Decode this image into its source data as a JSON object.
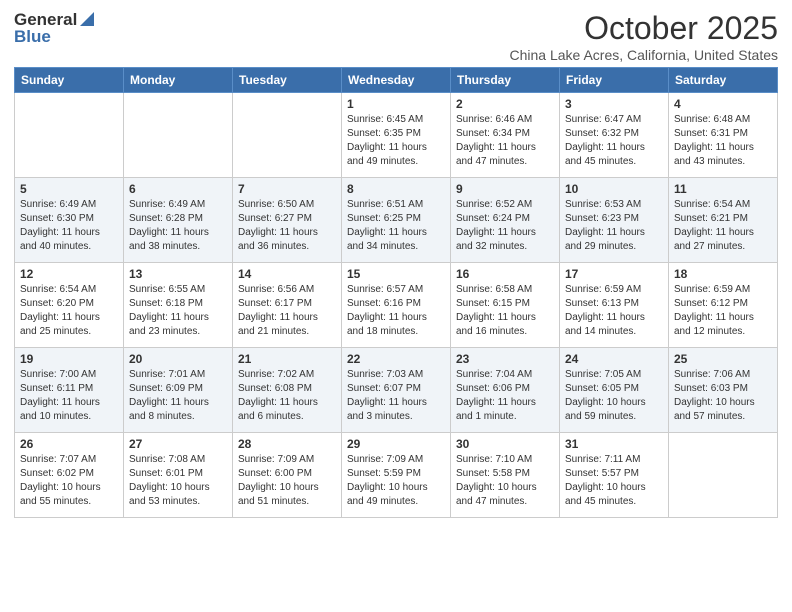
{
  "logo": {
    "general": "General",
    "blue": "Blue"
  },
  "title": "October 2025",
  "subtitle": "China Lake Acres, California, United States",
  "weekdays": [
    "Sunday",
    "Monday",
    "Tuesday",
    "Wednesday",
    "Thursday",
    "Friday",
    "Saturday"
  ],
  "weeks": [
    [
      {
        "day": "",
        "info": ""
      },
      {
        "day": "",
        "info": ""
      },
      {
        "day": "",
        "info": ""
      },
      {
        "day": "1",
        "info": "Sunrise: 6:45 AM\nSunset: 6:35 PM\nDaylight: 11 hours\nand 49 minutes."
      },
      {
        "day": "2",
        "info": "Sunrise: 6:46 AM\nSunset: 6:34 PM\nDaylight: 11 hours\nand 47 minutes."
      },
      {
        "day": "3",
        "info": "Sunrise: 6:47 AM\nSunset: 6:32 PM\nDaylight: 11 hours\nand 45 minutes."
      },
      {
        "day": "4",
        "info": "Sunrise: 6:48 AM\nSunset: 6:31 PM\nDaylight: 11 hours\nand 43 minutes."
      }
    ],
    [
      {
        "day": "5",
        "info": "Sunrise: 6:49 AM\nSunset: 6:30 PM\nDaylight: 11 hours\nand 40 minutes."
      },
      {
        "day": "6",
        "info": "Sunrise: 6:49 AM\nSunset: 6:28 PM\nDaylight: 11 hours\nand 38 minutes."
      },
      {
        "day": "7",
        "info": "Sunrise: 6:50 AM\nSunset: 6:27 PM\nDaylight: 11 hours\nand 36 minutes."
      },
      {
        "day": "8",
        "info": "Sunrise: 6:51 AM\nSunset: 6:25 PM\nDaylight: 11 hours\nand 34 minutes."
      },
      {
        "day": "9",
        "info": "Sunrise: 6:52 AM\nSunset: 6:24 PM\nDaylight: 11 hours\nand 32 minutes."
      },
      {
        "day": "10",
        "info": "Sunrise: 6:53 AM\nSunset: 6:23 PM\nDaylight: 11 hours\nand 29 minutes."
      },
      {
        "day": "11",
        "info": "Sunrise: 6:54 AM\nSunset: 6:21 PM\nDaylight: 11 hours\nand 27 minutes."
      }
    ],
    [
      {
        "day": "12",
        "info": "Sunrise: 6:54 AM\nSunset: 6:20 PM\nDaylight: 11 hours\nand 25 minutes."
      },
      {
        "day": "13",
        "info": "Sunrise: 6:55 AM\nSunset: 6:18 PM\nDaylight: 11 hours\nand 23 minutes."
      },
      {
        "day": "14",
        "info": "Sunrise: 6:56 AM\nSunset: 6:17 PM\nDaylight: 11 hours\nand 21 minutes."
      },
      {
        "day": "15",
        "info": "Sunrise: 6:57 AM\nSunset: 6:16 PM\nDaylight: 11 hours\nand 18 minutes."
      },
      {
        "day": "16",
        "info": "Sunrise: 6:58 AM\nSunset: 6:15 PM\nDaylight: 11 hours\nand 16 minutes."
      },
      {
        "day": "17",
        "info": "Sunrise: 6:59 AM\nSunset: 6:13 PM\nDaylight: 11 hours\nand 14 minutes."
      },
      {
        "day": "18",
        "info": "Sunrise: 6:59 AM\nSunset: 6:12 PM\nDaylight: 11 hours\nand 12 minutes."
      }
    ],
    [
      {
        "day": "19",
        "info": "Sunrise: 7:00 AM\nSunset: 6:11 PM\nDaylight: 11 hours\nand 10 minutes."
      },
      {
        "day": "20",
        "info": "Sunrise: 7:01 AM\nSunset: 6:09 PM\nDaylight: 11 hours\nand 8 minutes."
      },
      {
        "day": "21",
        "info": "Sunrise: 7:02 AM\nSunset: 6:08 PM\nDaylight: 11 hours\nand 6 minutes."
      },
      {
        "day": "22",
        "info": "Sunrise: 7:03 AM\nSunset: 6:07 PM\nDaylight: 11 hours\nand 3 minutes."
      },
      {
        "day": "23",
        "info": "Sunrise: 7:04 AM\nSunset: 6:06 PM\nDaylight: 11 hours\nand 1 minute."
      },
      {
        "day": "24",
        "info": "Sunrise: 7:05 AM\nSunset: 6:05 PM\nDaylight: 10 hours\nand 59 minutes."
      },
      {
        "day": "25",
        "info": "Sunrise: 7:06 AM\nSunset: 6:03 PM\nDaylight: 10 hours\nand 57 minutes."
      }
    ],
    [
      {
        "day": "26",
        "info": "Sunrise: 7:07 AM\nSunset: 6:02 PM\nDaylight: 10 hours\nand 55 minutes."
      },
      {
        "day": "27",
        "info": "Sunrise: 7:08 AM\nSunset: 6:01 PM\nDaylight: 10 hours\nand 53 minutes."
      },
      {
        "day": "28",
        "info": "Sunrise: 7:09 AM\nSunset: 6:00 PM\nDaylight: 10 hours\nand 51 minutes."
      },
      {
        "day": "29",
        "info": "Sunrise: 7:09 AM\nSunset: 5:59 PM\nDaylight: 10 hours\nand 49 minutes."
      },
      {
        "day": "30",
        "info": "Sunrise: 7:10 AM\nSunset: 5:58 PM\nDaylight: 10 hours\nand 47 minutes."
      },
      {
        "day": "31",
        "info": "Sunrise: 7:11 AM\nSunset: 5:57 PM\nDaylight: 10 hours\nand 45 minutes."
      },
      {
        "day": "",
        "info": ""
      }
    ]
  ]
}
